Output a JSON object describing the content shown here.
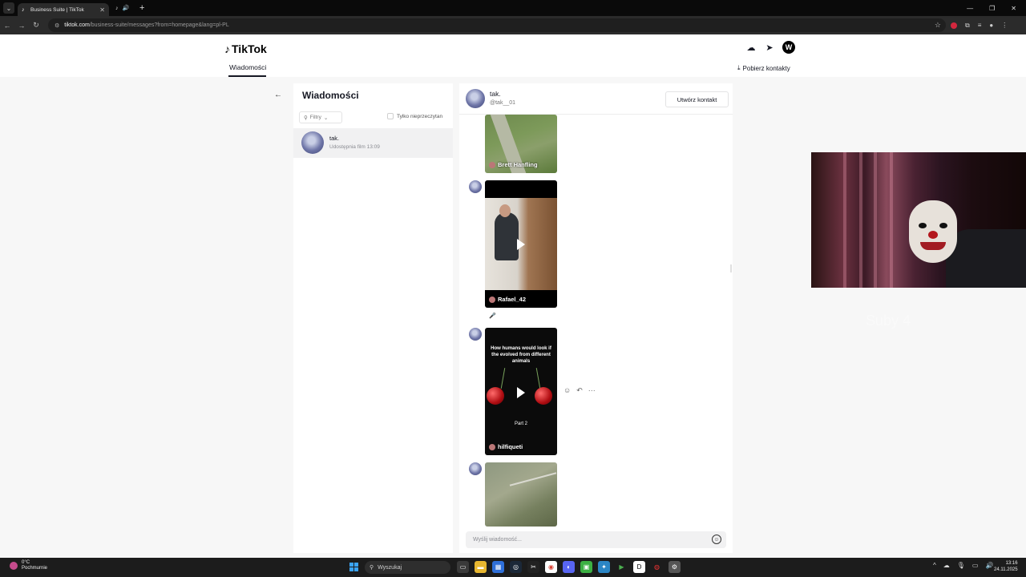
{
  "browser": {
    "tab_title": "Business Suite | TikTok",
    "url_host": "tiktok.com",
    "url_path": "/business-suite/messages?from=homepage&lang=pl-PL"
  },
  "header": {
    "logo": "TikTok",
    "nav_tab": "Wiadomości",
    "download_contacts": "Pobierz kontakty",
    "avatar_letter": "W"
  },
  "messages_panel": {
    "title": "Wiadomości",
    "filter_label": "Filtry",
    "unread_label": "Tylko nieprzeczytan",
    "conversations": [
      {
        "name": "tak.",
        "preview": "Udostępnia film",
        "time": "13:09"
      }
    ]
  },
  "chat": {
    "name": "tak.",
    "handle": "@tak__01",
    "create_contact": "Utwórz kontakt",
    "videos": [
      {
        "author": "Brett Hanfling"
      },
      {
        "author": "Rafael_42"
      },
      {
        "author": "hilfiqueti",
        "caption": "How humans would look if the evolved from different animals",
        "part": "Part 2"
      },
      {
        "author": ""
      }
    ],
    "input_placeholder": "Wyślij wiadomość..."
  },
  "overlay": {
    "text": "Suby 4"
  },
  "taskbar": {
    "temp": "0°C",
    "weather": "Pochmurnie",
    "search": "Wyszukaj",
    "time": "13:16",
    "date": "24.11.2025"
  },
  "colors": {
    "tiktok_text": "#161823",
    "chrome_bg": "#2b2b2b"
  }
}
